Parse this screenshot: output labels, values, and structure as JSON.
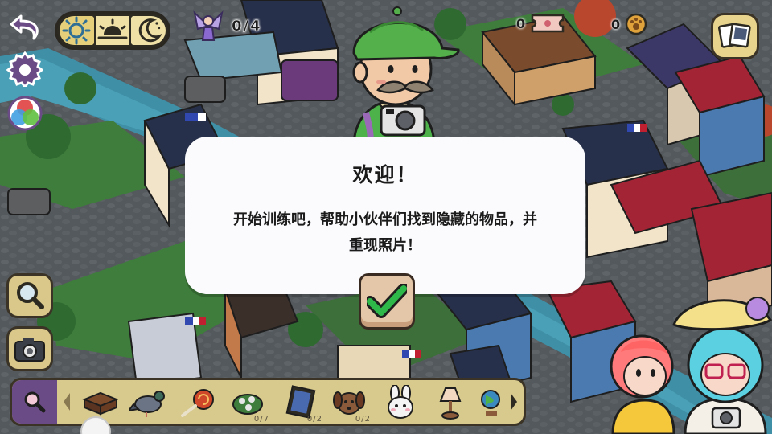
{
  "dialog": {
    "title": "欢迎！",
    "body_line1": "开始训练吧，帮助小伙伴们找到隐藏的物品，并",
    "body_line2": "重现照片！"
  },
  "counters": {
    "fairies": "0/4",
    "tickets": "0",
    "coins": "0"
  },
  "time_of_day": {
    "options": [
      "day",
      "sunset",
      "night"
    ],
    "selected": "day"
  },
  "item_bar": {
    "items": [
      {
        "icon": "brownie-tray-icon",
        "count": ""
      },
      {
        "icon": "pigeon-icon",
        "count": ""
      },
      {
        "icon": "lollipop-icon",
        "count": ""
      },
      {
        "icon": "rose-bush-icon",
        "count": "0/7"
      },
      {
        "icon": "picture-frame-icon",
        "count": "0/2"
      },
      {
        "icon": "puppy-icon",
        "count": "0/2"
      },
      {
        "icon": "bunny-icon",
        "count": ""
      },
      {
        "icon": "lamp-icon",
        "count": ""
      },
      {
        "icon": "globe-icon",
        "count": ""
      }
    ]
  },
  "colors": {
    "confirm_check": "#2fb84a",
    "item_bar_bg": "#d8c98c",
    "search_tab": "#6b4b86",
    "dialog_bg": "#fbfbfd"
  }
}
